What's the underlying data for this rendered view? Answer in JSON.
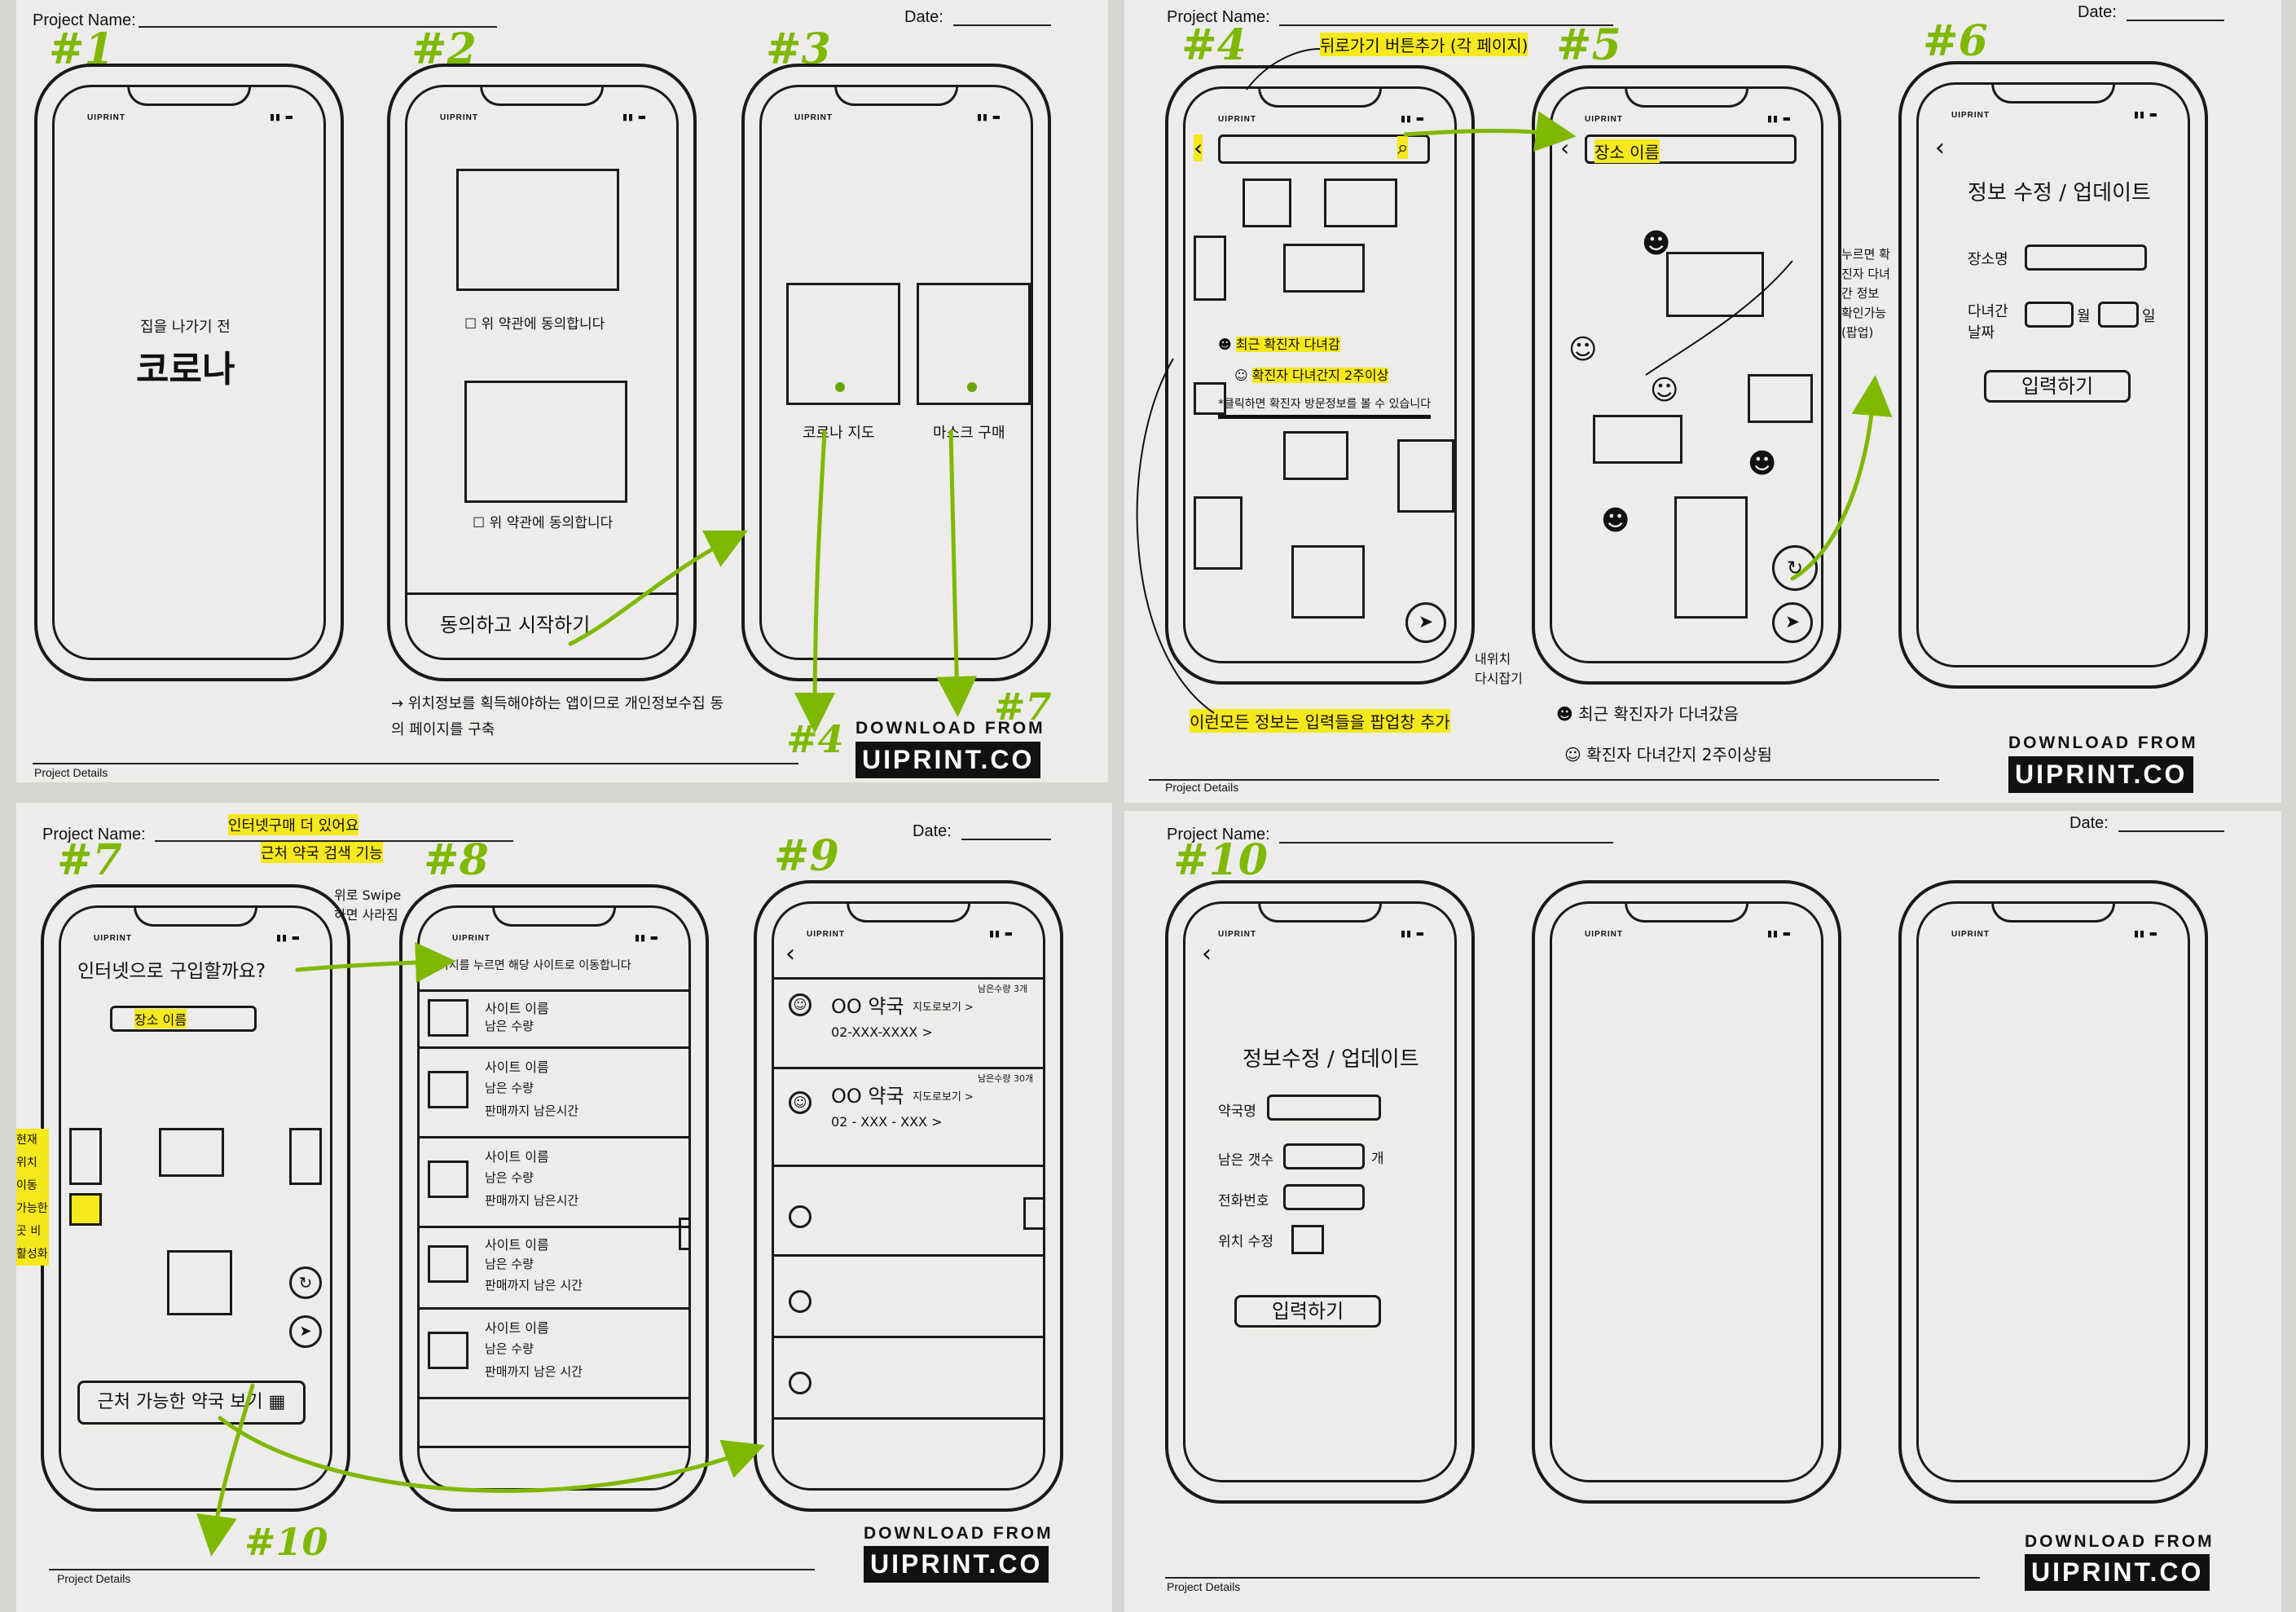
{
  "sheet_labels": {
    "project_name": "Project Name:",
    "date": "Date:",
    "project_details": "Project Details",
    "download_from": "DOWNLOAD FROM",
    "uiprint": "UIPRINT.CO",
    "phone_brand": "UIPRINT"
  },
  "screen_numbers": [
    "#1",
    "#2",
    "#3",
    "#4",
    "#5",
    "#6",
    "#7",
    "#8",
    "#9",
    "#10"
  ],
  "screen1": {
    "subtitle": "집을 나가기 전",
    "title": "코로나"
  },
  "screen2": {
    "checkbox1": "위 약관에 동의합니다",
    "checkbox2": "위 약관에 동의합니다",
    "start_button": "동의하고 시작하기",
    "note": "→ 위치정보를 획득해야하는 앱이므로 개인정보수집 동의 페이지를 구축"
  },
  "screen3": {
    "option1": "코로나 지도",
    "option2": "마스크 구매"
  },
  "screen4": {
    "annotation_top": "뒤로가기 버튼추가 (각 페이지)",
    "legend1": "최근 확진자 다녀감",
    "legend2": "확진자 다녀간지 2주이상",
    "legend3": "*클릭하면 확진자 방문정보를 볼 수 있습니다",
    "side_note": "내위치 다시잡기",
    "bottom_note": "이런모든 정보는 입력들을 팝업창 추가"
  },
  "screen5": {
    "search_text": "장소 이름",
    "side_note": "누르면 확진자 다녀간 정보 확인가능 (팝업)",
    "legend1": "최근 확진자가 다녀갔음",
    "legend2": "확진자 다녀간지 2주이상됨"
  },
  "screen6": {
    "title": "정보 수정 / 업데이트",
    "field1": "장소명",
    "field2": "다녀간 날짜",
    "unit_month": "월",
    "unit_day": "일",
    "submit": "입력하기"
  },
  "screen7": {
    "annotation_top1": "인터넷구매 더 있어요",
    "annotation_top2": "근처 약국 검색 기능",
    "annotation_swipe": "위로 Swipe 하면 사라짐",
    "question": "인터넷으로 구입할까요?",
    "search_text": "장소 이름",
    "side_note": "현재 위치 이동 가능한 곳 비활성화",
    "bottom_button": "근처 가능한 약국 보기"
  },
  "screen8": {
    "header": "이미지를 누르면 해당 사이트로 이동합니다",
    "items": [
      {
        "name": "사이트 이름",
        "line2": "남은 수량",
        "line3": ""
      },
      {
        "name": "사이트 이름",
        "line2": "남은 수량",
        "line3": "판매까지 남은시간"
      },
      {
        "name": "사이트 이름",
        "line2": "남은 수량",
        "line3": "판매까지 남은시간"
      },
      {
        "name": "사이트 이름",
        "line2": "남은 수량",
        "line3": "판매까지 남은 시간"
      },
      {
        "name": "사이트 이름",
        "line2": "남은 수량",
        "line3": "판매까지 남은 시간"
      }
    ]
  },
  "screen9": {
    "items": [
      {
        "name": "OO 약국",
        "map_link": "지도로보기 >",
        "phone": "02-XXX-XXXX >",
        "stock": "남은수량 3개"
      },
      {
        "name": "OO 약국",
        "map_link": "지도로보기 >",
        "phone": "02 - XXX - XXX >",
        "stock": "남은수량 30개"
      }
    ]
  },
  "screen10": {
    "title": "정보수정 / 업데이트",
    "field1": "약국명",
    "field2": "남은 갯수",
    "unit": "개",
    "field3": "전화번호",
    "field4": "위치 수정",
    "submit": "입력하기"
  },
  "colors": {
    "paper": "#ececea",
    "highlight": "#f5e81c",
    "arrow_green": "#7fb800",
    "ink": "#111111"
  }
}
